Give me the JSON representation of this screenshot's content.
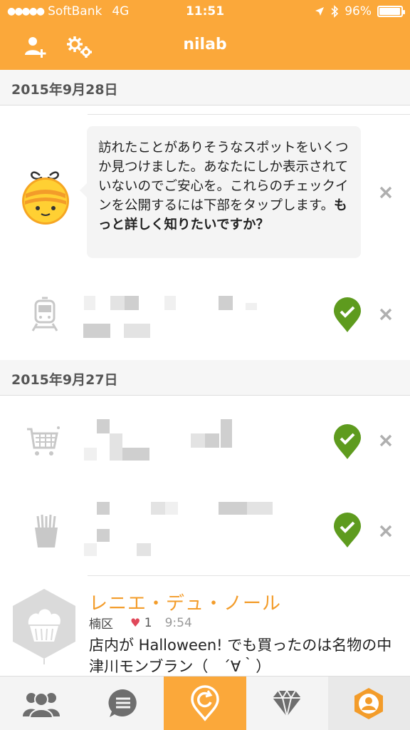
{
  "status_bar": {
    "signal": "●●●●●",
    "carrier": "SoftBank",
    "network": "4G",
    "time": "11:51",
    "battery": "96%",
    "battery_level": 0.96
  },
  "nav": {
    "title": "nilab",
    "add_friend_icon": "add-person-icon",
    "settings_icon": "gear-icon",
    "color": "#FBA83A"
  },
  "sections": [
    {
      "date": "2015年9月28日"
    },
    {
      "date": "2015年9月27日"
    }
  ],
  "suggestion": {
    "text": "訪れたことがありそうなスポットをいくつか見つけました。あなたにしか表示されていないのでご安心を。これらのチェックインを公開するには下部をタップします。",
    "bold_text": "もっと詳しく知りたいですか？"
  },
  "checkins": [
    {
      "icon": "train-icon"
    },
    {
      "icon": "shopping-cart-icon"
    },
    {
      "icon": "fries-icon"
    }
  ],
  "post": {
    "venue": "レニエ・デュ・ノール",
    "area": "楠区",
    "likes": "1",
    "time": "9:54",
    "text": "店内が Halloween! でも買ったのは名物の中津川モンブラン（　´∀｀）"
  },
  "tabs": [
    {
      "name": "friends",
      "icon": "people-icon"
    },
    {
      "name": "messages",
      "icon": "chat-icon"
    },
    {
      "name": "checkin",
      "icon": "checkin-pin-icon",
      "active": true
    },
    {
      "name": "rewards",
      "icon": "diamond-icon"
    },
    {
      "name": "profile",
      "icon": "profile-icon"
    }
  ]
}
